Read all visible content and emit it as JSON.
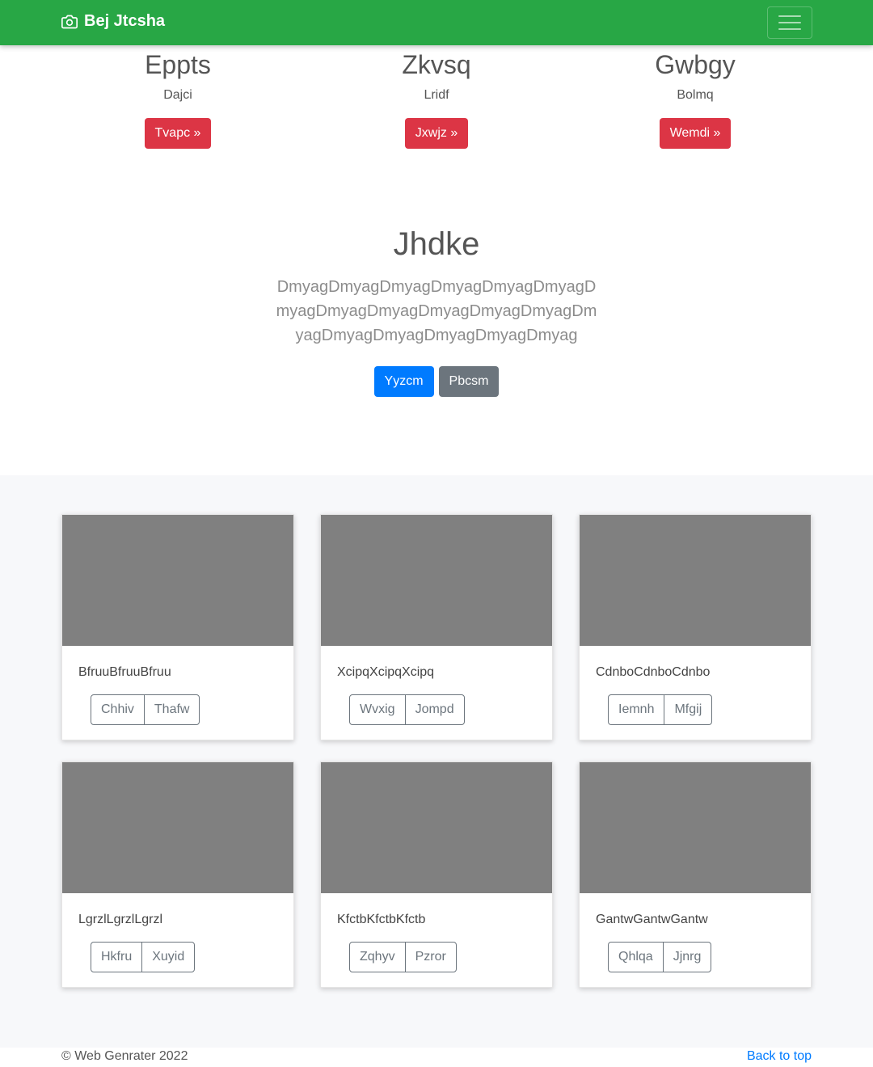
{
  "navbar": {
    "brand": "Bej Jtcsha",
    "brand_icon": "camera-icon",
    "toggler_icon": "hamburger-icon",
    "color": "#28a745"
  },
  "features": [
    {
      "title": "Eppts",
      "text": "Dajci",
      "button": "Tvapc »"
    },
    {
      "title": "Zkvsq",
      "text": "Lridf",
      "button": "Jxwjz »"
    },
    {
      "title": "Gwbgy",
      "text": "Bolmq",
      "button": "Wemdi »"
    }
  ],
  "hero": {
    "title": "Jhdke",
    "lead": "DmyagDmyagDmyagDmyagDmyagDmyagDmyagDmyagDmyagDmyagDmyagDmyagDmyagDmyagDmyagDmyagDmyagDmyag",
    "primary_button": "Yyzcm",
    "secondary_button": "Pbcsm"
  },
  "cards": [
    {
      "text": "BfruuBfruuBfruu",
      "buttons": [
        "Chhiv",
        "Thafw"
      ]
    },
    {
      "text": "XcipqXcipqXcipq",
      "buttons": [
        "Wvxig",
        "Jompd"
      ]
    },
    {
      "text": "CdnboCdnboCdnbo",
      "buttons": [
        "Iemnh",
        "Mfgij"
      ]
    },
    {
      "text": "LgrzlLgrzlLgrzl",
      "buttons": [
        "Hkfru",
        "Xuyid"
      ]
    },
    {
      "text": "KfctbKfctbKfctb",
      "buttons": [
        "Zqhyv",
        "Pzror"
      ]
    },
    {
      "text": "GantwGantwGantw",
      "buttons": [
        "Qhlqa",
        "Jjnrg"
      ]
    }
  ],
  "footer": {
    "copyright": "© Web Genrater 2022",
    "back_to_top": "Back to top"
  },
  "colors": {
    "danger": "#dc3545",
    "primary": "#007bff",
    "secondary": "#6c757d",
    "placeholder": "#808080"
  }
}
